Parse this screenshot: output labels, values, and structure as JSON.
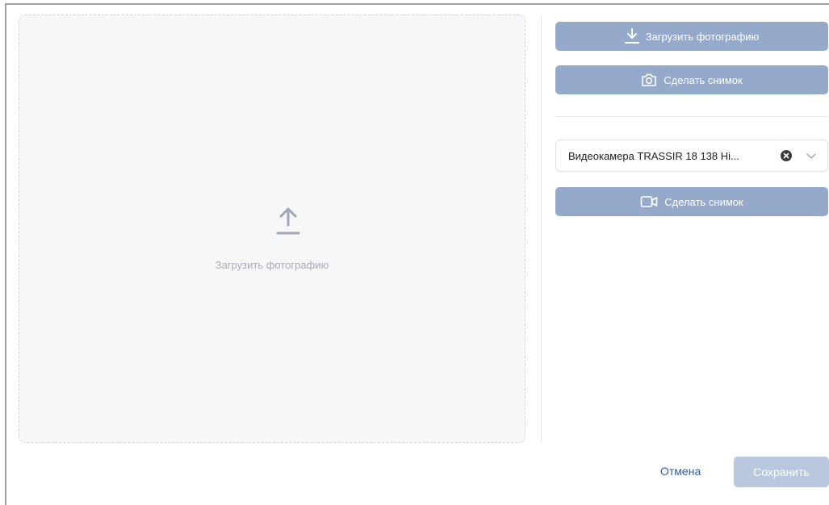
{
  "dropzone": {
    "label": "Загрузить фотографию",
    "icon": "upload-arrow-icon"
  },
  "actions": {
    "upload_button": {
      "label": "Загрузить фотографию",
      "icon": "download-arrow-icon"
    },
    "snapshot_button": {
      "label": "Сделать снимок",
      "icon": "camera-icon"
    },
    "camera_snapshot_button": {
      "label": "Сделать снимок",
      "icon": "video-camera-icon"
    }
  },
  "camera_select": {
    "value": "Видеокамера TRASSIR 18 138 Hi..."
  },
  "footer": {
    "cancel_label": "Отмена",
    "save_label": "Сохранить"
  },
  "colors": {
    "button_bg": "#95aacb",
    "save_disabled_bg": "#b9c8de",
    "link": "#2f5c9c"
  }
}
